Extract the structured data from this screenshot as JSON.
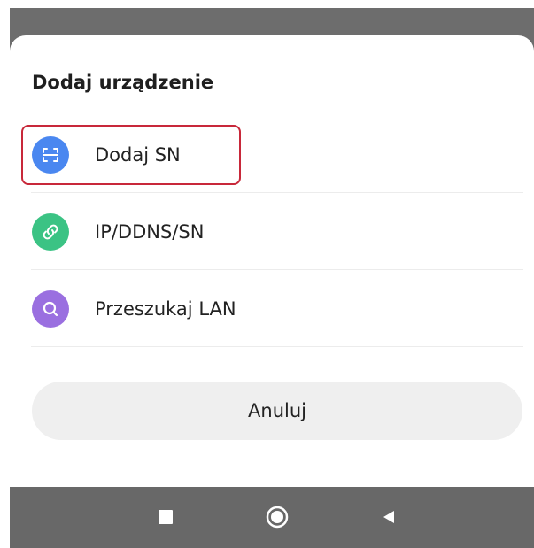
{
  "sheet": {
    "title": "Dodaj urządzenie",
    "options": [
      {
        "label": "Dodaj SN",
        "icon": "scan-icon",
        "color": "#4a87f0"
      },
      {
        "label": "IP/DDNS/SN",
        "icon": "link-icon",
        "color": "#3bc384"
      },
      {
        "label": "Przeszukaj LAN",
        "icon": "search-icon",
        "color": "#9a6fe0"
      }
    ],
    "cancel_label": "Anuluj"
  },
  "navbar": {
    "recents_icon": "square-icon",
    "home_icon": "circle-icon",
    "back_icon": "triangle-back-icon"
  },
  "colors": {
    "highlight": "#c8283a",
    "backdrop": "#6d6d6d",
    "navbar": "#686868"
  }
}
